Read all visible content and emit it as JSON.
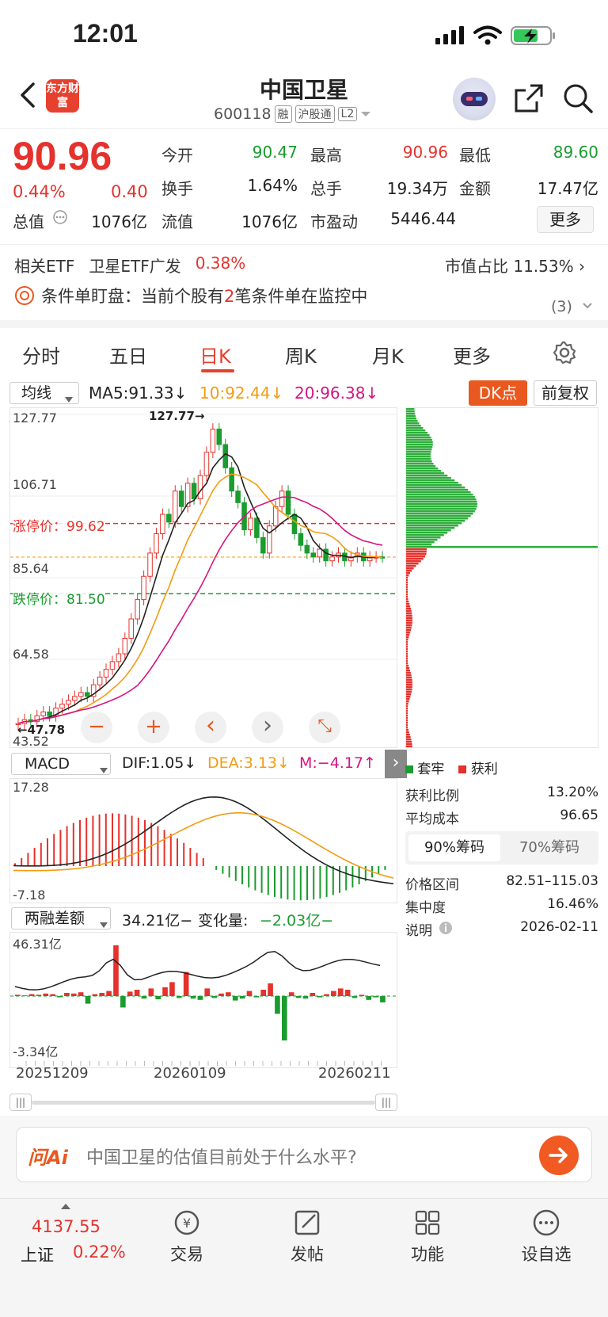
{
  "status_bar": {
    "time": "12:01"
  },
  "header": {
    "title": "中国卫星",
    "code": "600118",
    "tags": [
      "融",
      "沪股通",
      "L2"
    ],
    "brand": "东方财富"
  },
  "quote": {
    "price": "90.96",
    "change_pct": "0.44%",
    "change": "0.40",
    "rows": [
      [
        {
          "label": "今开",
          "value": "90.47",
          "color": "green"
        },
        {
          "label": "最高",
          "value": "90.96",
          "color": "red"
        },
        {
          "label": "最低",
          "value": "89.60",
          "color": "green"
        }
      ],
      [
        {
          "label": "换手",
          "value": "1.64%",
          "color": "black"
        },
        {
          "label": "总手",
          "value": "19.34万",
          "color": "black"
        },
        {
          "label": "金额",
          "value": "17.47亿",
          "color": "black"
        }
      ],
      [
        {
          "label": "总值",
          "value": "1076亿",
          "color": "black"
        },
        {
          "label": "流值",
          "value": "1076亿",
          "color": "black"
        },
        {
          "label": "市盈动",
          "value": "5446.44",
          "color": "black"
        }
      ]
    ],
    "more_label": "更多"
  },
  "etf": {
    "label": "相关ETF",
    "name": "卫星ETF广发",
    "pct": "0.38%",
    "mcap_label": "市值占比",
    "mcap_value": "11.53%"
  },
  "condition": {
    "prefix": "条件单盯盘：当前个股有",
    "count": "2",
    "suffix": "笔条件单在监控中",
    "badge": "(3)"
  },
  "tabs": [
    "分时",
    "五日",
    "日K",
    "周K",
    "月K",
    "更多",
    ""
  ],
  "ma_bar": {
    "select": "均线",
    "ma5": "MA5:91.33↓",
    "ma10": "10:92.44↓",
    "ma20": "20:96.38↓",
    "dk": "DK点",
    "fq": "前复权"
  },
  "kline": {
    "y_labels": [
      "127.77",
      "106.71",
      "85.64",
      "64.58",
      "43.52"
    ],
    "max_label": "127.77",
    "min_label": "47.78",
    "limit_up": "涨停价：99.62",
    "limit_down": "跌停价：81.50",
    "chart_controls": [
      "−",
      "+",
      "‹",
      "›",
      "⤡"
    ]
  },
  "macd": {
    "select": "MACD",
    "dif": "DIF:1.05↓",
    "dea": "DEA:3.13↓",
    "m": "M:−4.17↑",
    "top": "17.28",
    "bottom": "-7.18"
  },
  "margin": {
    "select": "两融差额",
    "value": "34.21亿−",
    "change_label": "变化量:",
    "change_value": "−2.03亿−",
    "top": "46.31亿",
    "bottom": "-3.34亿"
  },
  "x_labels": [
    "20251209",
    "20260109",
    "20260211"
  ],
  "chips": {
    "legend_trap": "套牢",
    "legend_profit": "获利",
    "rows": [
      {
        "label": "获利比例",
        "value": "13.20%"
      },
      {
        "label": "平均成本",
        "value": "96.65"
      }
    ],
    "tab_90": "90%筹码",
    "tab_70": "70%筹码",
    "rows2": [
      {
        "label": "价格区间",
        "value": "82.51–115.03"
      },
      {
        "label": "集中度",
        "value": "16.46%"
      },
      {
        "label": "说明",
        "value": "2026-02-11"
      }
    ]
  },
  "ai": {
    "logo": "问Ai",
    "placeholder": "中国卫星的估值目前处于什么水平?"
  },
  "nav": {
    "index_value": "4137.55",
    "index_name": "上证",
    "index_pct": "0.22%",
    "items": [
      "交易",
      "发帖",
      "功能",
      "设自选"
    ]
  },
  "colors": {
    "up": "#e5322d",
    "down": "#1a9c2e",
    "accent": "#e8402e",
    "ma10": "#f39c12",
    "ma20": "#d6157f"
  }
}
